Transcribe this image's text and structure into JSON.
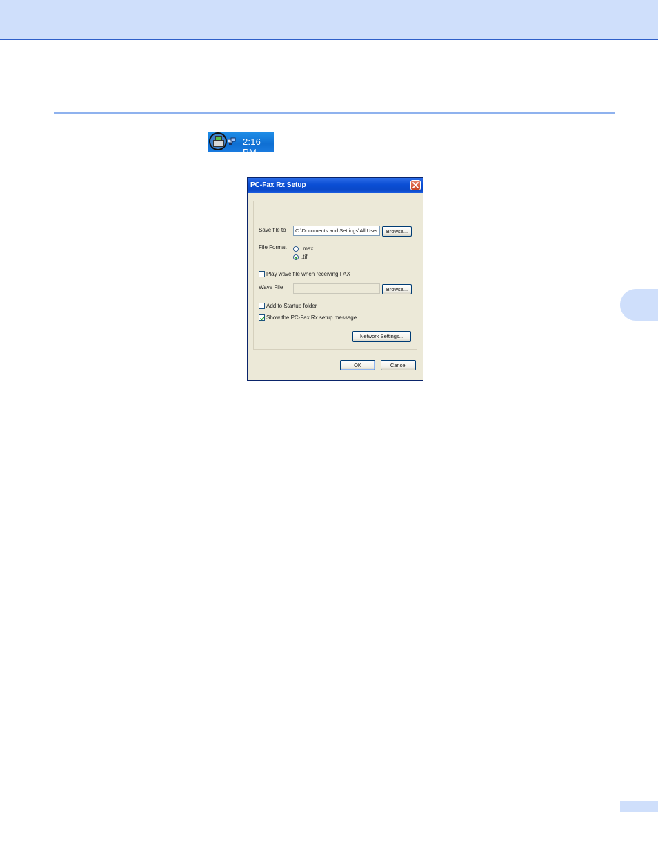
{
  "systray": {
    "clock": "2:16 PM",
    "icons": [
      "fax-icon",
      "network-icon"
    ]
  },
  "dialog": {
    "title": "PC-Fax Rx Setup",
    "save_file_to": {
      "label": "Save file to",
      "value": "C:\\Documents and Settings\\All User",
      "browse_label": "Browse..."
    },
    "file_format": {
      "label": "File Format",
      "options": [
        {
          "label": ".max",
          "checked": false
        },
        {
          "label": ".tif",
          "checked": true
        }
      ]
    },
    "play_wave": {
      "label": "Play wave file when receiving FAX",
      "checked": false
    },
    "wave_file": {
      "label": "Wave File",
      "value": "",
      "browse_label": "Browse..."
    },
    "add_startup": {
      "label": "Add to Startup folder",
      "checked": false
    },
    "show_message": {
      "label": "Show the PC-Fax Rx setup message",
      "checked": true
    },
    "network_settings_label": "Network Settings...",
    "ok_label": "OK",
    "cancel_label": "Cancel"
  },
  "colors": {
    "header_band": "#cfdffb",
    "header_line": "#2f5fc8",
    "section_rule": "#8fb2ee",
    "dialog_face": "#ece9d8",
    "titlebar": "#0a4ed4"
  }
}
